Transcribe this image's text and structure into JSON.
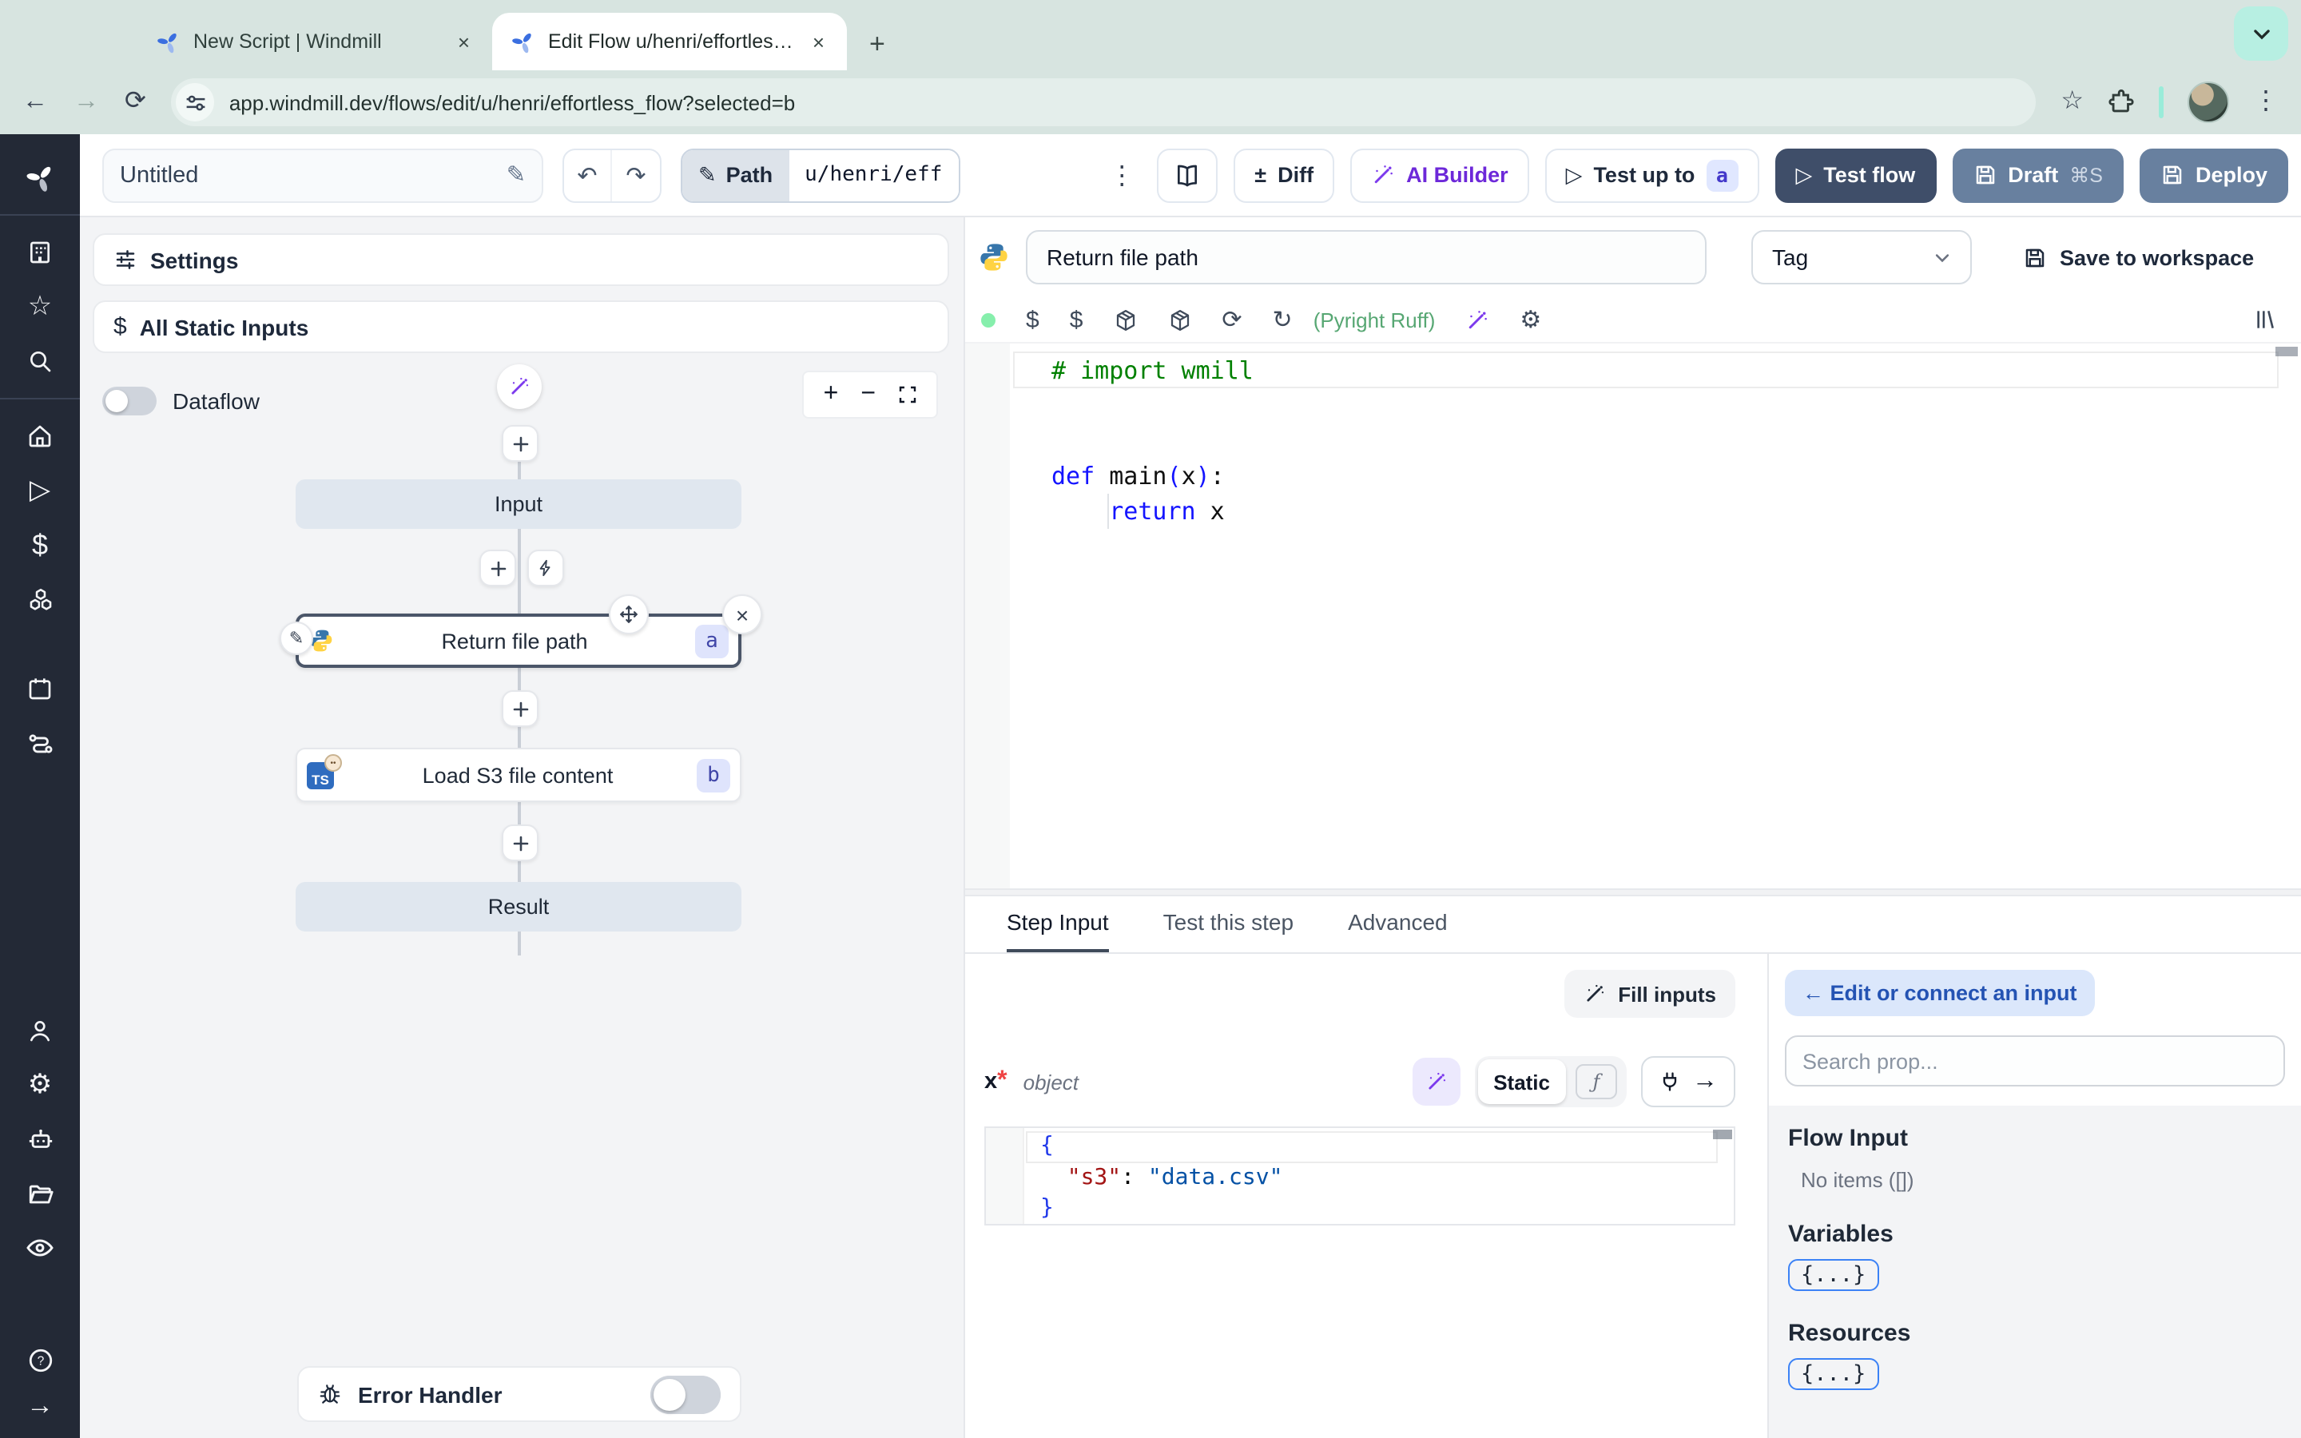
{
  "browser": {
    "tabs": [
      {
        "title": "New Script | Windmill"
      },
      {
        "title": "Edit Flow u/henri/effortless_fl"
      }
    ],
    "url": "app.windmill.dev/flows/edit/u/henri/effortless_flow?selected=b"
  },
  "topbar": {
    "flow_name": "Untitled",
    "path_label": "Path",
    "path_value": "u/henri/eff",
    "diff_label": "Diff",
    "ai_builder_label": "AI Builder",
    "test_up_to_label": "Test up to",
    "test_up_to_badge": "a",
    "test_flow_label": "Test flow",
    "draft_label": "Draft",
    "draft_shortcut": "⌘S",
    "deploy_label": "Deploy"
  },
  "flow_panel": {
    "settings_label": "Settings",
    "static_inputs_label": "All Static Inputs",
    "dataflow_label": "Dataflow",
    "input_node": "Input",
    "step_a_title": "Return file path",
    "step_a_badge": "a",
    "step_b_title": "Load S3 file content",
    "step_b_badge": "b",
    "step_b_lang": "TS",
    "result_node": "Result",
    "error_handler_label": "Error Handler"
  },
  "editor": {
    "step_name": "Return file path",
    "tag_label": "Tag",
    "save_label": "Save to workspace",
    "lint_label": "(Pyright Ruff)",
    "tokens": {
      "comment": "# import wmill",
      "kw_def": "def",
      "fn_name": " main",
      "paren_open": "(",
      "arg": "x",
      "paren_close": ")",
      "colon": ":",
      "indent": "    ",
      "kw_return": "return",
      "ret_arg": " x"
    }
  },
  "step_panel": {
    "tabs": [
      "Step Input",
      "Test this step",
      "Advanced"
    ],
    "fill_inputs_label": "Fill inputs",
    "arg_name": "x",
    "arg_required_mark": "*",
    "arg_type": "object",
    "static_label": "Static",
    "fx_glyph": "ƒ",
    "json": {
      "open_brace": "{",
      "indent": "  ",
      "key": "\"s3\"",
      "colon": ": ",
      "value": "\"data.csv\"",
      "close_brace": "}"
    }
  },
  "connect_panel": {
    "edit_connect_label": "← Edit or connect an input",
    "search_placeholder": "Search prop...",
    "flow_input_label": "Flow Input",
    "no_items_label": "No items ([])",
    "variables_label": "Variables",
    "resources_label": "Resources",
    "braces_chip": "{...}"
  },
  "colors": {
    "accent_purple": "#7c3aed",
    "mint_chrome": "#d7e4e0",
    "sidebar_dark": "#232936",
    "primary_dark_button": "#3f4e69",
    "slate_button": "#68809f",
    "badge_bg": "#dfe4fc",
    "lint_green": "#57a773",
    "selected_node_border": "#4b5669"
  }
}
